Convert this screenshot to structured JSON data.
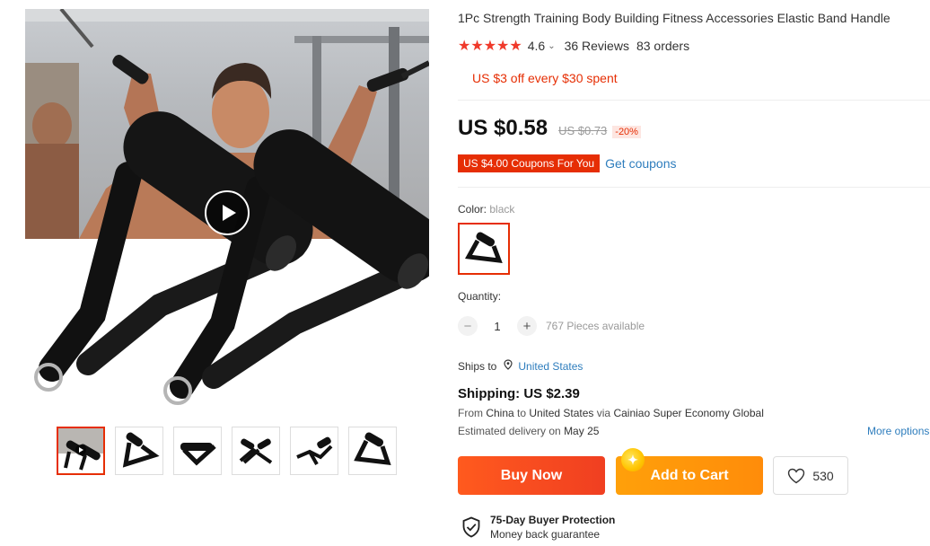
{
  "product": {
    "title": "1Pc Strength Training Body Building Fitness Accessories Elastic Band Handle",
    "rating": "4.6",
    "reviews": "36 Reviews",
    "orders": "83 orders",
    "promo": "US $3 off every $30 spent",
    "price": "US $0.58",
    "old_price": "US $0.73",
    "discount": "-20%",
    "coupon_badge": "US $4.00 Coupons For You",
    "get_coupons": "Get coupons"
  },
  "color": {
    "label": "Color:",
    "value": "black"
  },
  "quantity": {
    "label": "Quantity:",
    "value": "1",
    "minus": "−",
    "plus": "+",
    "available": "767 Pieces available"
  },
  "shipping": {
    "ships_to_label": "Ships to",
    "country": "United States",
    "cost": "Shipping: US $2.39",
    "from_label": "From",
    "from": "China",
    "to_label": "to",
    "to": "United States",
    "via_label": "via",
    "carrier": "Cainiao Super Economy Global",
    "delivery_label": "Estimated delivery on",
    "delivery_date": "May 25",
    "more_options": "More options"
  },
  "actions": {
    "buy_now": "Buy Now",
    "add_to_cart": "Add to Cart",
    "wishlist_count": "530"
  },
  "protection": {
    "title": "75-Day Buyer Protection",
    "subtitle": "Money back guarantee"
  },
  "colors": {
    "accent": "#e62e04",
    "star": "#f0392a",
    "link": "#2e7dbd",
    "buy_now": "#f03f21",
    "add_to_cart": "#ff9a0a"
  },
  "icons": {
    "play": "play-icon",
    "pin": "location-pin-icon",
    "heart": "heart-icon",
    "shield": "shield-check-icon",
    "chevron": "chevron-down-icon",
    "coin": "coin-icon"
  }
}
